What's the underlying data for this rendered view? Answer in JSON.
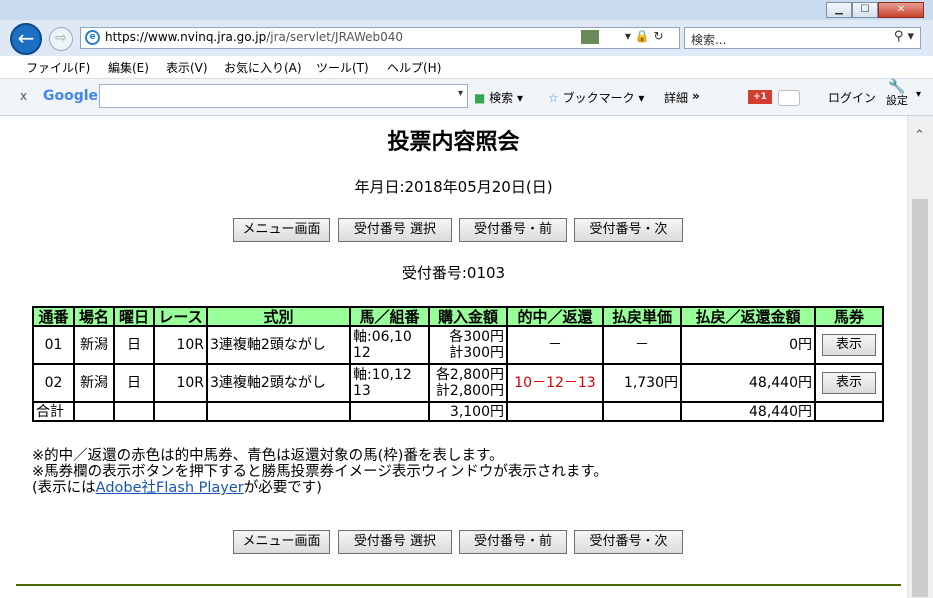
{
  "browser": {
    "window_buttons": {
      "minimize": "▁",
      "maximize": "☐",
      "close": "✕"
    },
    "url_scheme": "https://",
    "url_host": "www.nvinq.jra.go.jp",
    "url_path": "/jra/servlet/JRAWeb040",
    "search_placeholder": "検索...",
    "menu": [
      "ファイル(F)",
      "編集(E)",
      "表示(V)",
      "お気に入り(A)",
      "ツール(T)",
      "ヘルプ(H)"
    ],
    "toolbar": {
      "close_x": "x",
      "google": "Google",
      "search_label": "検索",
      "bookmark_label": "ブックマーク",
      "detail_label": "詳細",
      "more": "»",
      "gplus": "+1",
      "login": "ログイン",
      "settings": "設定"
    }
  },
  "page": {
    "title": "投票内容照会",
    "date_line": "年月日:2018年05月20日(日)",
    "buttons": {
      "menu": "メニュー画面",
      "select": "受付番号 選択",
      "prev": "受付番号・前",
      "next": "受付番号・次"
    },
    "receipt_number_line": "受付番号:0103",
    "table": {
      "headers": [
        "通番",
        "場名",
        "曜日",
        "レース",
        "式別",
        "馬／組番",
        "購入金額",
        "的中／返還",
        "払戻単価",
        "払戻／返還金額",
        "馬券"
      ],
      "rows": [
        {
          "no": "01",
          "venue": "新潟",
          "day": "日",
          "race": "10R",
          "type": "3連複軸2頭ながし",
          "combo_1": "軸:06,10",
          "combo_2": "12",
          "amount_1": "各300円",
          "amount_2": "計300円",
          "hit": "－",
          "unit_payout": "－",
          "payout": "0円",
          "ticket": "表示"
        },
        {
          "no": "02",
          "venue": "新潟",
          "day": "日",
          "race": "10R",
          "type": "3連複軸2頭ながし",
          "combo_1": "軸:10,12",
          "combo_2": "13",
          "amount_1": "各2,800円",
          "amount_2": "計2,800円",
          "hit": "10－12－13",
          "unit_payout": "1,730円",
          "payout": "48,440円",
          "ticket": "表示"
        }
      ],
      "total": {
        "label": "合計",
        "amount": "3,100円",
        "payout": "48,440円"
      }
    },
    "notes": {
      "line1": "※的中／返還の赤色は的中馬券、青色は返還対象の馬(枠)番を表します。",
      "line2": "※馬券欄の表示ボタンを押下すると勝馬投票券イメージ表示ウィンドウが表示されます。",
      "line3_pre": "(表示には",
      "line3_link": "Adobe社Flash Player",
      "line3_post": "が必要です)"
    }
  },
  "colors": {
    "header_bg": "#99ff99",
    "hit_red": "#d40000",
    "link": "#1a56b5"
  }
}
